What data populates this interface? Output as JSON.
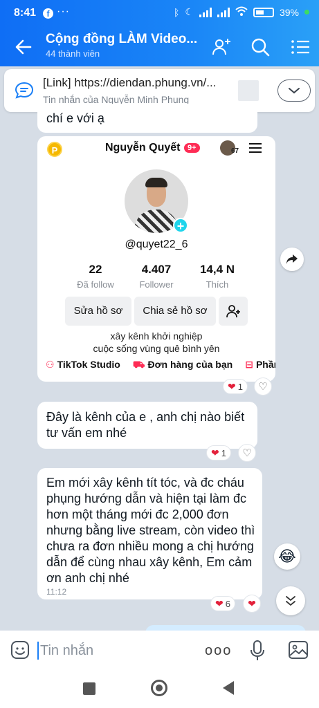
{
  "status": {
    "time": "8:41",
    "battery": "39%"
  },
  "header": {
    "title": "Cộng đồng LÀM Video...",
    "members": "44 thành viên"
  },
  "pinned": {
    "title": "[Link] https://diendan.phung.vn/...",
    "subtitle": "Tin nhắn của Nguyễn Minh Phụng"
  },
  "messages": {
    "prev_text": "chí e với ạ",
    "tiktok": {
      "name": "Nguyễn Quyết",
      "badge": "9+",
      "mini_count": "67",
      "coin": "P",
      "handle": "@quyet22_6",
      "stats": [
        {
          "num": "22",
          "label": "Đã follow"
        },
        {
          "num": "4.407",
          "label": "Follower"
        },
        {
          "num": "14,4 N",
          "label": "Thích"
        }
      ],
      "edit_label": "Sửa hồ sơ",
      "share_label": "Chia sẻ hồ sơ",
      "bio_line1": "xây kênh khởi nghiệp",
      "bio_line2": "cuộc sống vùng quê bình yên",
      "link1": "TikTok Studio",
      "link2": "Đơn hàng của bạn",
      "link3": "Phần t"
    },
    "img_reaction_count": "1",
    "msg2_text": "Đây là kênh của e , anh chị nào biết tư vấn em nhé",
    "msg2_reaction_count": "1",
    "msg3_text": "Em mới xây kênh tít tóc, và đc cháu phụng hướng dẫn và hiện tại làm đc hơn một tháng mới đc 2,000 đơn nhưng bằng live stream, còn video thì chưa ra đơn nhiều mong a chị hướng dẫn để cùng nhau xây kênh, Em cảm ơn anh chị nhé",
    "msg3_time": "11:12",
    "msg3_reaction_count": "6"
  },
  "composer": {
    "placeholder": "Tin nhắn"
  },
  "colors": {
    "header_start": "#0f6ef5",
    "header_end": "#2aa0f7",
    "heart": "#e3213b",
    "tiktok_pink": "#fe2c55"
  }
}
